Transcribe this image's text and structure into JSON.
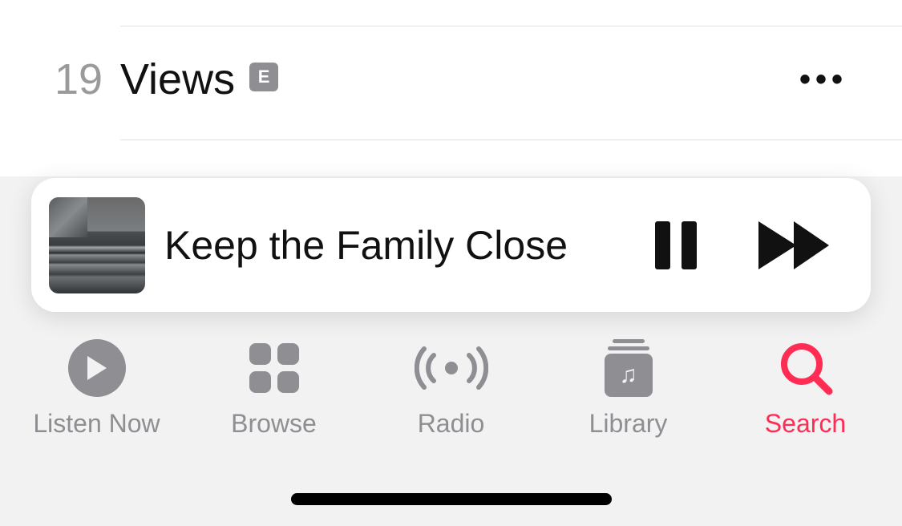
{
  "track": {
    "number": "19",
    "title": "Views",
    "explicit": "E"
  },
  "nowPlaying": {
    "title": "Keep the Family Close"
  },
  "tabs": {
    "listenNow": "Listen Now",
    "browse": "Browse",
    "radio": "Radio",
    "library": "Library",
    "search": "Search"
  },
  "colors": {
    "accent": "#ff2d54",
    "inactive": "#8e8e93"
  }
}
